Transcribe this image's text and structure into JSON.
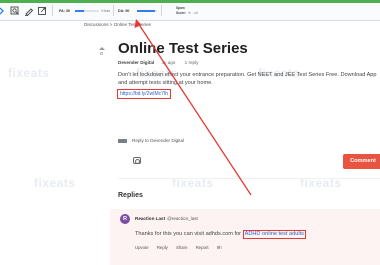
{
  "toolbar": {
    "pa_label": "PA: 39",
    "da_label": "DA: 90",
    "links_label": "0 links",
    "spam_label": "Spam",
    "score_label": "Score:",
    "spam_value": "% - .ull",
    "pa_value": 39,
    "da_value": 90
  },
  "breadcrumb": "Discussions > Online Test Series",
  "watermark": "fixeats",
  "post": {
    "vote_count": "0",
    "title": "Online Test Series",
    "author": "Devender Digital",
    "ago": "4y ago",
    "reply_count": "1 reply",
    "body": "Don't let lockdown effect your entrance preparation. Get NEET and JEE Test Series Free. Download App and attempt tests sitting at your home.",
    "link": "https://bit.ly/2wIMc7Ih"
  },
  "reply_box": {
    "label": "Reply to Devender Digital",
    "comment_button": "Comment"
  },
  "replies": {
    "heading": "Replies",
    "items": [
      {
        "avatar_letter": "R",
        "name": "Reaction Last",
        "handle": "@reaction_last",
        "text": "Thanks for this you can visit adhds.com for",
        "link_text": "ADHD online test adults",
        "actions": [
          "Upvote",
          "Reply",
          "Share",
          "Report",
          "9h"
        ]
      }
    ]
  },
  "colors": {
    "accent": "#e8543f",
    "annotation": "#e53935",
    "link": "#2d62c9",
    "avatar": "#7b4ea3"
  }
}
